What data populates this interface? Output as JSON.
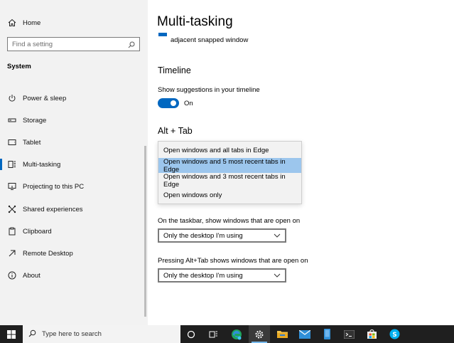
{
  "sidebar": {
    "home_label": "Home",
    "search_placeholder": "Find a setting",
    "section_label": "System",
    "items": [
      {
        "label": "Power & sleep",
        "icon": "power-icon"
      },
      {
        "label": "Storage",
        "icon": "storage-icon"
      },
      {
        "label": "Tablet",
        "icon": "tablet-icon"
      },
      {
        "label": "Multi-tasking",
        "icon": "multitasking-icon",
        "active": true
      },
      {
        "label": "Projecting to this PC",
        "icon": "projecting-icon"
      },
      {
        "label": "Shared experiences",
        "icon": "shared-experiences-icon"
      },
      {
        "label": "Clipboard",
        "icon": "clipboard-icon"
      },
      {
        "label": "Remote Desktop",
        "icon": "remote-desktop-icon"
      },
      {
        "label": "About",
        "icon": "info-icon"
      }
    ]
  },
  "main": {
    "title": "Multi-tasking",
    "snap_option_tail": "adjacent snapped window",
    "timeline": {
      "heading": "Timeline",
      "suggestions_label": "Show suggestions in your timeline",
      "toggle_state": "On"
    },
    "alt_tab": {
      "heading": "Alt + Tab",
      "options": [
        "Open windows and all tabs in Edge",
        "Open windows and 5 most recent tabs in Edge",
        "Open windows and 3 most recent tabs in Edge",
        "Open windows only"
      ],
      "selected_index": 1
    },
    "taskbar_windows": {
      "label": "On the taskbar, show windows that are open on",
      "value": "Only the desktop I'm using"
    },
    "alttab_windows": {
      "label": "Pressing Alt+Tab shows windows that are open on",
      "value": "Only the desktop I'm using"
    }
  },
  "taskbar": {
    "search_placeholder": "Type here to search",
    "icons": [
      "windows-start-icon",
      "cortana-icon",
      "task-view-icon",
      "edge-icon",
      "settings-icon",
      "file-explorer-icon",
      "mail-icon",
      "phone-icon",
      "terminal-icon",
      "store-icon",
      "skype-icon"
    ]
  },
  "colors": {
    "accent": "#0067c0",
    "selection": "#9cc6ed",
    "taskbar": "#1f1f1f"
  }
}
